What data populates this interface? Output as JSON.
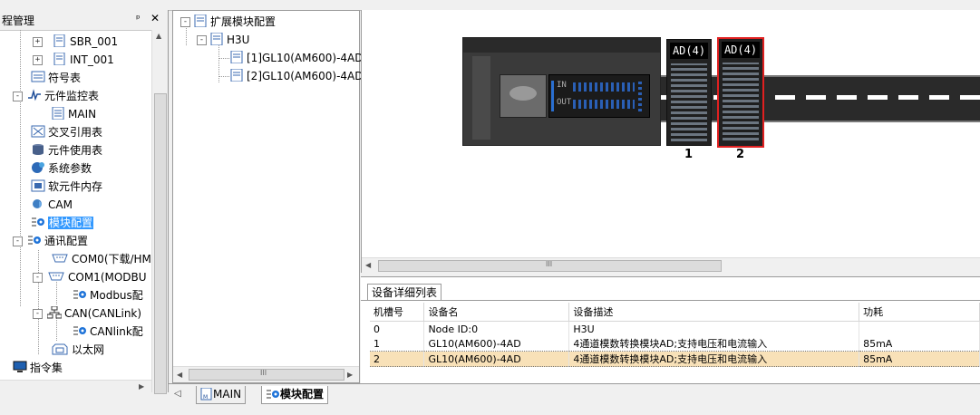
{
  "left_panel": {
    "title": "程管理",
    "pin_icon": "pin-icon",
    "close_icon": "close-icon",
    "items": [
      {
        "label": "SBR_001"
      },
      {
        "label": "INT_001"
      },
      {
        "label": "符号表"
      },
      {
        "label": "元件监控表"
      },
      {
        "label": "MAIN"
      },
      {
        "label": "交叉引用表"
      },
      {
        "label": "元件使用表"
      },
      {
        "label": "系统参数"
      },
      {
        "label": "软元件内存"
      },
      {
        "label": "CAM"
      },
      {
        "label": "模块配置"
      },
      {
        "label": "通讯配置"
      },
      {
        "label": "COM0(下载/HM"
      },
      {
        "label": "COM1(MODBU"
      },
      {
        "label": "Modbus配"
      },
      {
        "label": "CAN(CANLink)"
      },
      {
        "label": "CANlink配"
      },
      {
        "label": "以太网"
      },
      {
        "label": "指令集"
      }
    ]
  },
  "mid_tree": {
    "root": "扩展模块配置",
    "plc": "H3U",
    "modules": [
      "[1]GL10(AM600)-4AD",
      "[2]GL10(AM600)-4AD"
    ]
  },
  "graph": {
    "module_label": "AD(4)",
    "slots": [
      "1",
      "2"
    ],
    "plc_panel": {
      "in": "IN",
      "out": "OUT"
    },
    "selected_slot": "2",
    "selected_color": "#e02020"
  },
  "detail": {
    "tab_label": "设备详细列表",
    "columns": [
      "机槽号",
      "设备名",
      "设备描述",
      "功耗"
    ],
    "rows": [
      [
        "0",
        "Node ID:0",
        "H3U",
        ""
      ],
      [
        "1",
        "GL10(AM600)-4AD",
        "4通道模数转换模块AD;支持电压和电流输入",
        "85mA"
      ],
      [
        "2",
        "GL10(AM600)-4AD",
        "4通道模数转换模块AD;支持电压和电流输入",
        "85mA"
      ]
    ],
    "highlight_row": "2"
  },
  "tabs": {
    "main": "MAIN",
    "module": "模块配置"
  },
  "scroll": {
    "h_grip": "III",
    "v_grip": "≡"
  }
}
